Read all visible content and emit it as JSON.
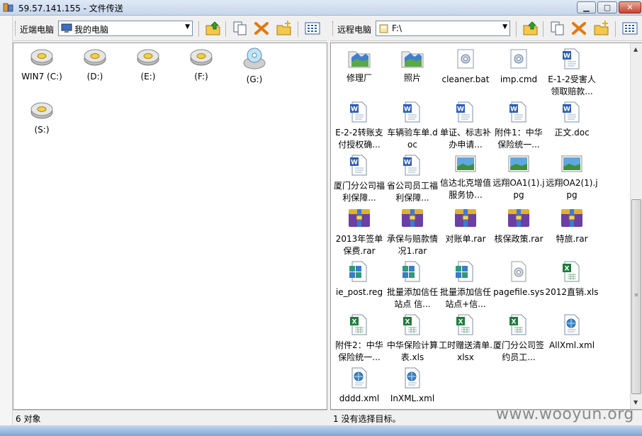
{
  "window": {
    "title": "59.57.141.155 - 文件传送"
  },
  "left_toolbar": {
    "label": "近端电脑",
    "location": "我的电脑"
  },
  "right_toolbar": {
    "label": "远程电脑",
    "location": "F:\\"
  },
  "toolbar_buttons": [
    {
      "name": "up-folder-icon"
    },
    {
      "name": "copy-icon"
    },
    {
      "name": "delete-icon"
    },
    {
      "name": "new-folder-icon"
    },
    {
      "name": "view-icon"
    }
  ],
  "left_items": [
    {
      "label": "WIN7 (C:)",
      "icon": "hard-drive-icon"
    },
    {
      "label": "(D:)",
      "icon": "hard-drive-icon"
    },
    {
      "label": "(E:)",
      "icon": "hard-drive-icon"
    },
    {
      "label": "(F:)",
      "icon": "hard-drive-icon"
    },
    {
      "label": "(G:)",
      "icon": "cd-drive-icon"
    },
    {
      "label": "(S:)",
      "icon": "hard-drive-icon"
    }
  ],
  "right_items": [
    {
      "label": "修理厂",
      "icon": "folder-image-icon"
    },
    {
      "label": "照片",
      "icon": "folder-image-icon"
    },
    {
      "label": "cleaner.bat",
      "icon": "batch-file-icon"
    },
    {
      "label": "imp.cmd",
      "icon": "batch-file-icon"
    },
    {
      "label": "E-1-2受害人领取赔款...",
      "icon": "word-doc-icon"
    },
    {
      "label": "E-2-2转账支付授权确...",
      "icon": "word-doc-icon"
    },
    {
      "label": "车辆验车单.doc",
      "icon": "word-doc-icon"
    },
    {
      "label": "单证、标志补办申请...",
      "icon": "word-doc-icon"
    },
    {
      "label": "附件1：中华保险统一...",
      "icon": "word-doc-icon"
    },
    {
      "label": "正文.doc",
      "icon": "word-doc-icon"
    },
    {
      "label": "厦门分公司福利保障...",
      "icon": "word-doc-icon"
    },
    {
      "label": "省公司员工福利保障...",
      "icon": "word-doc-icon"
    },
    {
      "label": "信达北克增值服务协...",
      "icon": "jpg-image-icon"
    },
    {
      "label": "远翔OA1(1).jpg",
      "icon": "jpg-image-icon"
    },
    {
      "label": "远翔OA2(1).jpg",
      "icon": "jpg-image-icon"
    },
    {
      "label": "2013年签单保费.rar",
      "icon": "rar-archive-icon"
    },
    {
      "label": "承保与赔款情况1.rar",
      "icon": "rar-archive-icon"
    },
    {
      "label": "对账单.rar",
      "icon": "rar-archive-icon"
    },
    {
      "label": "核保政策.rar",
      "icon": "rar-archive-icon"
    },
    {
      "label": "特旅.rar",
      "icon": "rar-archive-icon"
    },
    {
      "label": "ie_post.reg",
      "icon": "registry-file-icon"
    },
    {
      "label": "批量添加信任站点 信...",
      "icon": "registry-file-icon"
    },
    {
      "label": "批量添加信任站点+信...",
      "icon": "registry-file-icon"
    },
    {
      "label": "pagefile.sys",
      "icon": "system-file-icon"
    },
    {
      "label": "2012直销.xls",
      "icon": "excel-file-icon"
    },
    {
      "label": "附件2：中华保险统一...",
      "icon": "excel-file-icon"
    },
    {
      "label": "中华保险计算表.xls",
      "icon": "excel-file-icon"
    },
    {
      "label": "工时赠送清单.xlsx",
      "icon": "excel-file-icon"
    },
    {
      "label": "厦门分公司签约员工...",
      "icon": "excel-file-icon"
    },
    {
      "label": "AllXml.xml",
      "icon": "xml-file-icon"
    },
    {
      "label": "dddd.xml",
      "icon": "xml-file-icon"
    },
    {
      "label": "InXML.xml",
      "icon": "xml-file-icon"
    }
  ],
  "status": {
    "left": "6 对象",
    "right": "1 没有选择目标。"
  },
  "watermark": "www.wooyun.org"
}
